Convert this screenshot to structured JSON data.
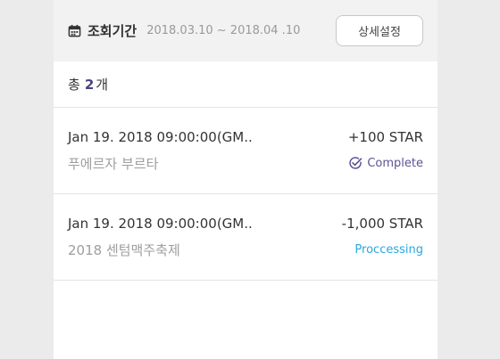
{
  "filter": {
    "label": "조회기간",
    "range": "2018.03.10 ~ 2018.04 .10",
    "detail_button": "상세설정",
    "icon": "calendar-icon"
  },
  "summary": {
    "prefix": "총",
    "count": "2",
    "suffix": "개"
  },
  "transactions": [
    {
      "date": "Jan 19. 2018 09:00:00(GM..",
      "name": "푸에르자 부르타",
      "amount": "+100 STAR",
      "status": "Complete",
      "status_icon": "check-circle-icon",
      "status_color": "#5a5394"
    },
    {
      "date": "Jan 19. 2018 09:00:00(GM..",
      "name": "2018 센텀맥주축제",
      "amount": "-1,000 STAR",
      "status": "Proccessing",
      "status_color": "#2aa7e0"
    }
  ],
  "colors": {
    "accent": "#4a4480",
    "background": "#ebebeb",
    "filter_bar": "#f2f2f2"
  }
}
